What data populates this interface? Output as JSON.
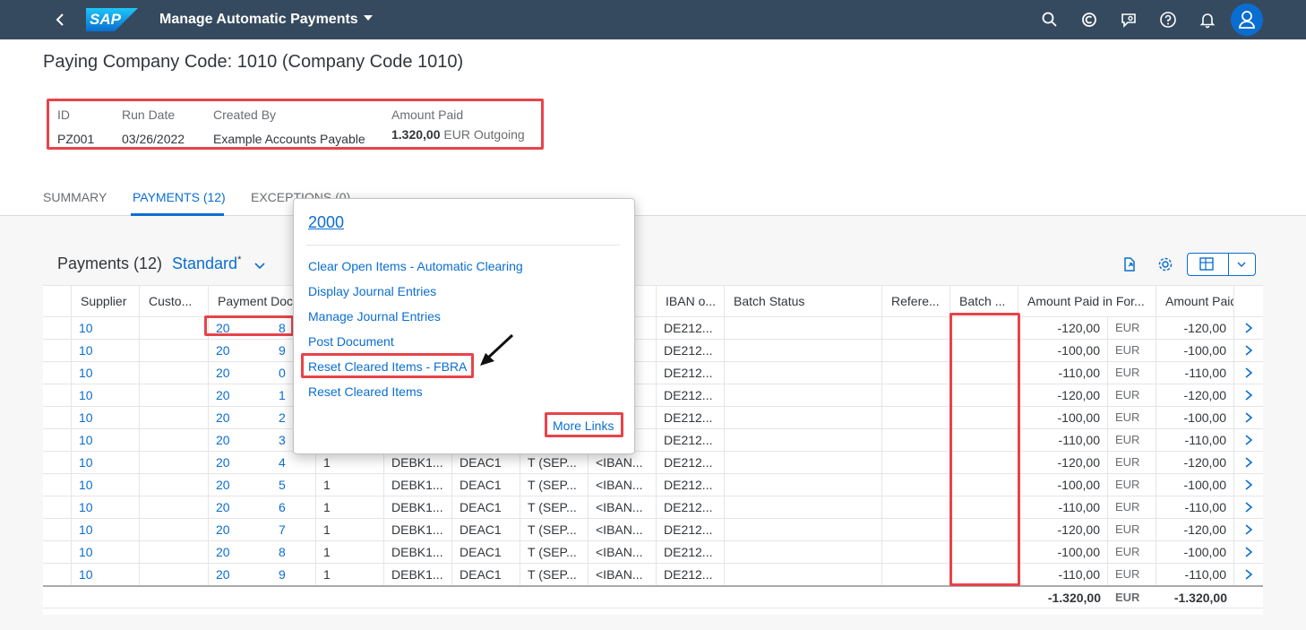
{
  "shell": {
    "logo_text": "SAP",
    "app_title": "Manage Automatic Payments",
    "icons": [
      "back-icon",
      "search-icon",
      "copilot-icon",
      "feedback-icon",
      "help-icon",
      "bell-icon",
      "user-icon"
    ],
    "color": "#354a5f",
    "avatar_color": "#0a6ed1"
  },
  "header": {
    "title": "Paying Company Code: 1010 (Company Code 1010)",
    "attributes": {
      "id_label": "ID",
      "id_value": "PZ001",
      "run_date_label": "Run Date",
      "run_date_value": "03/26/2022",
      "created_by_label": "Created By",
      "created_by_value": "Example Accounts Payable",
      "amount_paid_label": "Amount Paid",
      "amount_paid_value": "1.320,00",
      "amount_paid_suffix": "EUR Outgoing"
    },
    "tabs": [
      {
        "label": "SUMMARY",
        "active": false
      },
      {
        "label": "PAYMENTS (12)",
        "active": true
      },
      {
        "label": "EXCEPTIONS (0)",
        "active": false
      }
    ]
  },
  "table": {
    "title": "Payments (12)",
    "variant": "Standard",
    "variant_modified": "*",
    "columns": [
      "Supplier",
      "Custo...",
      "Payment Doc...",
      "",
      "",
      "",
      "",
      "",
      "IBAN o...",
      "Batch Status",
      "Refere...",
      "Batch ...",
      "Amount Paid in For...",
      "",
      "Amount Paid"
    ],
    "rows": [
      {
        "supplier": "10",
        "doc_prefix": "20",
        "doc_suffix": "8",
        "c1": "",
        "c2": "",
        "c3": "",
        "c4": "",
        "c5": "",
        "iban": "DE212...",
        "amount_fc": "-120,00",
        "currency": "EUR",
        "amount": "-120,00"
      },
      {
        "supplier": "10",
        "doc_prefix": "20",
        "doc_suffix": "9",
        "c1": "",
        "c2": "",
        "c3": "",
        "c4": "",
        "c5": "",
        "iban": "DE212...",
        "amount_fc": "-100,00",
        "currency": "EUR",
        "amount": "-100,00"
      },
      {
        "supplier": "10",
        "doc_prefix": "20",
        "doc_suffix": "0",
        "c1": "",
        "c2": "",
        "c3": "",
        "c4": "",
        "c5": "",
        "iban": "DE212...",
        "amount_fc": "-110,00",
        "currency": "EUR",
        "amount": "-110,00"
      },
      {
        "supplier": "10",
        "doc_prefix": "20",
        "doc_suffix": "1",
        "c1": "",
        "c2": "",
        "c3": "",
        "c4": "",
        "c5": "",
        "iban": "DE212...",
        "amount_fc": "-120,00",
        "currency": "EUR",
        "amount": "-120,00"
      },
      {
        "supplier": "10",
        "doc_prefix": "20",
        "doc_suffix": "2",
        "c1": "",
        "c2": "",
        "c3": "",
        "c4": "",
        "c5": "",
        "iban": "DE212...",
        "amount_fc": "-100,00",
        "currency": "EUR",
        "amount": "-100,00"
      },
      {
        "supplier": "10",
        "doc_prefix": "20",
        "doc_suffix": "3",
        "c1": "",
        "c2": "",
        "c3": "",
        "c4": "",
        "c5": "",
        "iban": "DE212...",
        "amount_fc": "-110,00",
        "currency": "EUR",
        "amount": "-110,00"
      },
      {
        "supplier": "10",
        "doc_prefix": "20",
        "doc_suffix": "4",
        "c1": "1",
        "c2": "DEBK1...",
        "c3": "DEAC1",
        "c4": "T (SEP...",
        "c5": "<IBAN...",
        "iban": "DE212...",
        "amount_fc": "-120,00",
        "currency": "EUR",
        "amount": "-120,00"
      },
      {
        "supplier": "10",
        "doc_prefix": "20",
        "doc_suffix": "5",
        "c1": "1",
        "c2": "DEBK1...",
        "c3": "DEAC1",
        "c4": "T (SEP...",
        "c5": "<IBAN...",
        "iban": "DE212...",
        "amount_fc": "-100,00",
        "currency": "EUR",
        "amount": "-100,00"
      },
      {
        "supplier": "10",
        "doc_prefix": "20",
        "doc_suffix": "6",
        "c1": "1",
        "c2": "DEBK1...",
        "c3": "DEAC1",
        "c4": "T (SEP...",
        "c5": "<IBAN...",
        "iban": "DE212...",
        "amount_fc": "-110,00",
        "currency": "EUR",
        "amount": "-110,00"
      },
      {
        "supplier": "10",
        "doc_prefix": "20",
        "doc_suffix": "7",
        "c1": "1",
        "c2": "DEBK1...",
        "c3": "DEAC1",
        "c4": "T (SEP...",
        "c5": "<IBAN...",
        "iban": "DE212...",
        "amount_fc": "-120,00",
        "currency": "EUR",
        "amount": "-120,00"
      },
      {
        "supplier": "10",
        "doc_prefix": "20",
        "doc_suffix": "8",
        "c1": "1",
        "c2": "DEBK1...",
        "c3": "DEAC1",
        "c4": "T (SEP...",
        "c5": "<IBAN...",
        "iban": "DE212...",
        "amount_fc": "-100,00",
        "currency": "EUR",
        "amount": "-100,00"
      },
      {
        "supplier": "10",
        "doc_prefix": "20",
        "doc_suffix": "9",
        "c1": "1",
        "c2": "DEBK1...",
        "c3": "DEAC1",
        "c4": "T (SEP...",
        "c5": "<IBAN...",
        "iban": "DE212...",
        "amount_fc": "-110,00",
        "currency": "EUR",
        "amount": "-110,00"
      }
    ],
    "totals": {
      "amount_fc": "-1.320,00",
      "currency": "EUR",
      "amount": "-1.320,00"
    }
  },
  "popover": {
    "title": "2000",
    "links": [
      "Clear Open Items - Automatic Clearing",
      "Display Journal Entries",
      "Manage Journal Entries",
      "Post Document",
      "Reset Cleared Items - FBRA",
      "Reset Cleared Items"
    ],
    "more_links": "More Links"
  },
  "colors": {
    "accent": "#0a6ed1",
    "highlight": "#e8434a"
  }
}
